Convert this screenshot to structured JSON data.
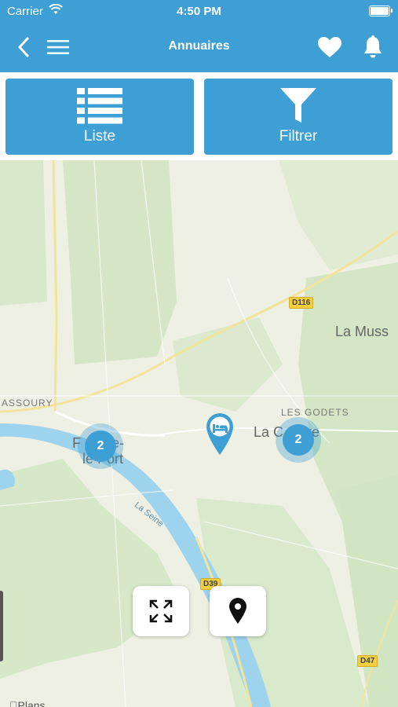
{
  "status_bar": {
    "carrier": "Carrier",
    "time": "4:50 PM"
  },
  "navbar": {
    "title": "Annuaires",
    "icons": [
      "back-icon",
      "menu-icon",
      "heart-icon",
      "bell-icon"
    ]
  },
  "actions": {
    "list_label": "Liste",
    "filter_label": "Filtrer"
  },
  "map": {
    "place_labels": {
      "la_muss": "La Muss",
      "assoury": "ASSOURY",
      "les_godets": "LES GODETS",
      "la_chaudre": "La C    dre",
      "fontaine": "F     ine-",
      "le_port": "le Port",
      "la_seine": "La Seine"
    },
    "road_labels": {
      "d116": "D116",
      "d39": "D39",
      "d47": "D47"
    },
    "clusters": [
      {
        "count": "2"
      },
      {
        "count": "2"
      }
    ],
    "attribution": "Plans"
  },
  "colors": {
    "primary": "#3d9fd3",
    "water": "#9dd3ec",
    "land": "#eef0e4",
    "park": "#d7e8c8",
    "road_badge": "#f2cf3e"
  }
}
